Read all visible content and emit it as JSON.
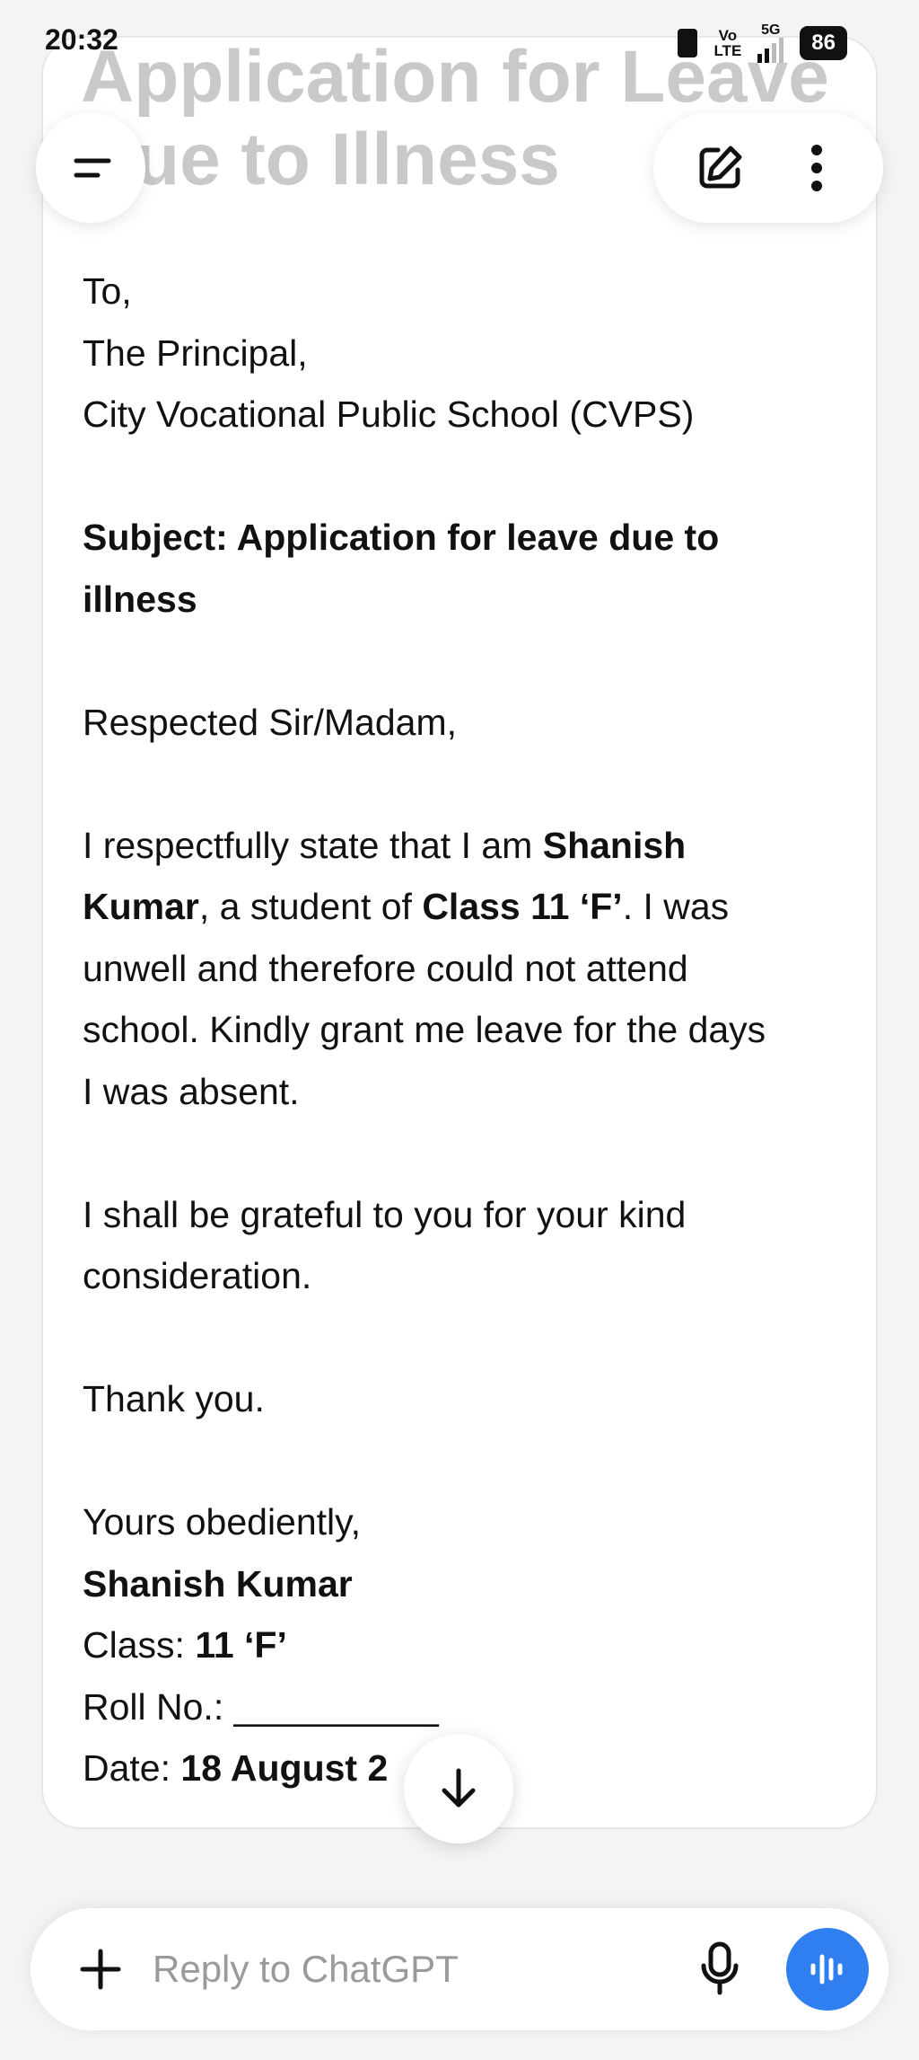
{
  "status": {
    "time": "20:32",
    "battery": "86",
    "volte_top": "Vo",
    "volte_bottom": "LTE",
    "network": "5G"
  },
  "header": {
    "title_line1": "Application for Leave",
    "title_line2": "ue to Illness",
    "icons": {
      "menu": "menu-icon",
      "compose": "edit-icon",
      "more": "more-vertical-icon"
    }
  },
  "letter": {
    "to": "To,",
    "recipient": "The Principal,",
    "school": "City Vocational Public School (CVPS)",
    "subject_line1": "Subject: Application for leave due to",
    "subject_line2": "illness",
    "salutation": "Respected Sir/Madam,",
    "body1": {
      "l1_pre": "I respectfully state that I am ",
      "l1_bold": "Shanish",
      "l2_bold": "Kumar",
      "l2_mid": ", a student of ",
      "l2_bold2": "Class 11 ‘F’",
      "l2_post": ". I was",
      "l3": "unwell and therefore could not attend",
      "l4": "school. Kindly grant me leave for the days",
      "l5": "I was absent."
    },
    "body2_line1": "I shall be grateful to you for your kind",
    "body2_line2": "consideration.",
    "thanks": "Thank you.",
    "closing": "Yours obediently,",
    "name": "Shanish Kumar",
    "class_label": "Class: ",
    "class_value": "11 ‘F’",
    "roll_label": "Roll No.: __________",
    "date_label": "Date: ",
    "date_value": "18 August 2"
  },
  "composer": {
    "placeholder": "Reply to ChatGPT",
    "accent": "#2f7ff0"
  }
}
